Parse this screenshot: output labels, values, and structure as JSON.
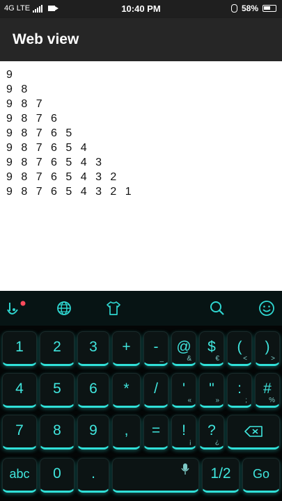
{
  "status_bar": {
    "network": "4G LTE",
    "time": "10:40 PM",
    "battery": "58%",
    "icons": [
      "signal-icon",
      "camera-icon",
      "bluetooth-icon",
      "battery-icon"
    ]
  },
  "app_bar": {
    "title": "Web view"
  },
  "webview": {
    "lines": [
      "9",
      "9 8",
      "9 8 7",
      "9 8 7 6",
      "9 8 7 6 5",
      "9 8 7 6 5 4",
      "9 8 7 6 5 4 3",
      "9 8 7 6 5 4 3 2",
      "9 8 7 6 5 4 3 2 1"
    ]
  },
  "keyboard": {
    "accent": "#30e0d8",
    "toolbar_icons": [
      "touchpal-icon",
      "globe-icon",
      "tshirt-icon",
      "search-icon",
      "emoji-icon"
    ],
    "row1": [
      {
        "label": "1",
        "sub": ""
      },
      {
        "label": "2",
        "sub": ""
      },
      {
        "label": "3",
        "sub": ""
      },
      {
        "label": "+",
        "sub": ""
      },
      {
        "label": "-",
        "sub": "_"
      },
      {
        "label": "@",
        "sub": "&"
      },
      {
        "label": "$",
        "sub": "€"
      },
      {
        "label": "(",
        "sub": "<"
      },
      {
        "label": ")",
        "sub": ">"
      }
    ],
    "row2": [
      {
        "label": "4",
        "sub": ""
      },
      {
        "label": "5",
        "sub": ""
      },
      {
        "label": "6",
        "sub": ""
      },
      {
        "label": "*",
        "sub": ""
      },
      {
        "label": "/",
        "sub": ""
      },
      {
        "label": "'",
        "sub": "«"
      },
      {
        "label": "\"",
        "sub": "»"
      },
      {
        "label": ":",
        "sub": ";"
      },
      {
        "label": "#",
        "sub": "%"
      }
    ],
    "row3": [
      {
        "label": "7",
        "sub": ""
      },
      {
        "label": "8",
        "sub": ""
      },
      {
        "label": "9",
        "sub": ""
      },
      {
        "label": ",",
        "sub": ""
      },
      {
        "label": "=",
        "sub": ""
      },
      {
        "label": "!",
        "sub": "¡"
      },
      {
        "label": "?",
        "sub": "¿"
      }
    ],
    "row4": {
      "abc": "abc",
      "zero": "0",
      "dot": ".",
      "half": "1/2",
      "go": "Go"
    }
  }
}
